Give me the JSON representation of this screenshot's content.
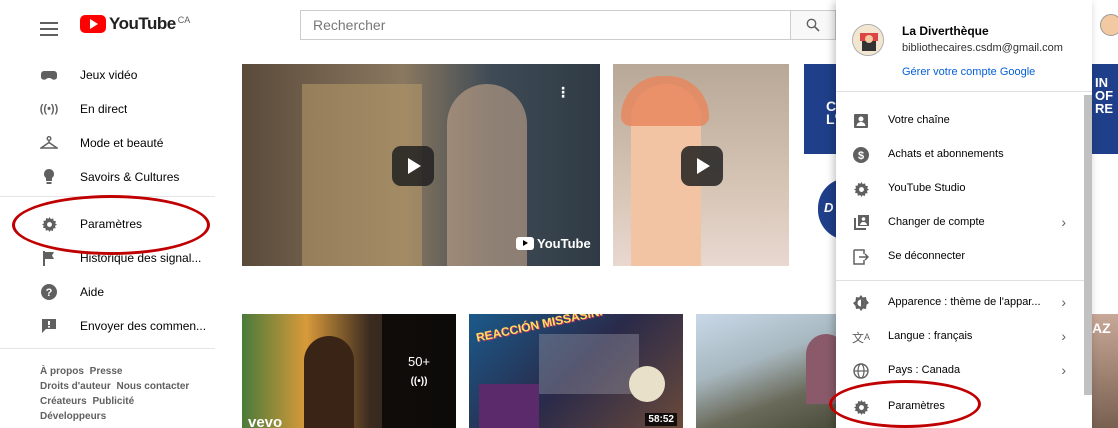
{
  "header": {
    "logo_text": "YouTube",
    "logo_country": "CA",
    "search_placeholder": "Rechercher"
  },
  "sidebar": {
    "items": [
      {
        "label": "Jeux vidéo",
        "icon": "gamepad-icon"
      },
      {
        "label": "En direct",
        "icon": "live-icon"
      },
      {
        "label": "Mode et beauté",
        "icon": "hanger-icon"
      },
      {
        "label": "Savoirs & Cultures",
        "icon": "lightbulb-icon"
      },
      {
        "label": "Paramètres",
        "icon": "gear-icon"
      },
      {
        "label": "Historique des signal...",
        "icon": "flag-icon"
      },
      {
        "label": "Aide",
        "icon": "help-icon"
      },
      {
        "label": "Envoyer des commen...",
        "icon": "feedback-icon"
      }
    ],
    "footer": [
      "À propos",
      "Presse",
      "Droits d'auteur",
      "Nous contacter",
      "Créateurs",
      "Publicité",
      "Développeurs"
    ]
  },
  "thumbnails": {
    "brand_overlay": "YouTube",
    "count_badge": "50+",
    "duration": "58:52",
    "vevo": "vevo",
    "reaction_title": "REACCIÓN MISSASINFONIA",
    "banner_text": "IN OF RE",
    "banner_left": "C L'",
    "badge_d": "D",
    "side_text": "AZ"
  },
  "account_menu": {
    "name": "La Diverthèque",
    "email": "bibliothecaires.csdm@gmail.com",
    "manage_link": "Gérer votre compte Google",
    "items": [
      {
        "label": "Votre chaîne",
        "icon": "person-icon",
        "chevron": false
      },
      {
        "label": "Achats et abonnements",
        "icon": "dollar-icon",
        "chevron": false
      },
      {
        "label": "YouTube Studio",
        "icon": "gear-icon",
        "chevron": false
      },
      {
        "label": "Changer de compte",
        "icon": "switch-account-icon",
        "chevron": true
      },
      {
        "label": "Se déconnecter",
        "icon": "sign-out-icon",
        "chevron": false
      },
      {
        "label": "Apparence : thème de l'appar...",
        "icon": "theme-icon",
        "chevron": true
      },
      {
        "label": "Langue : français",
        "icon": "translate-icon",
        "chevron": true
      },
      {
        "label": "Pays : Canada",
        "icon": "globe-icon",
        "chevron": true
      },
      {
        "label": "Paramètres",
        "icon": "gear-icon",
        "chevron": false
      }
    ]
  },
  "colors": {
    "brand": "#ff0000",
    "link": "#065fd4",
    "annotation": "#c00000"
  }
}
